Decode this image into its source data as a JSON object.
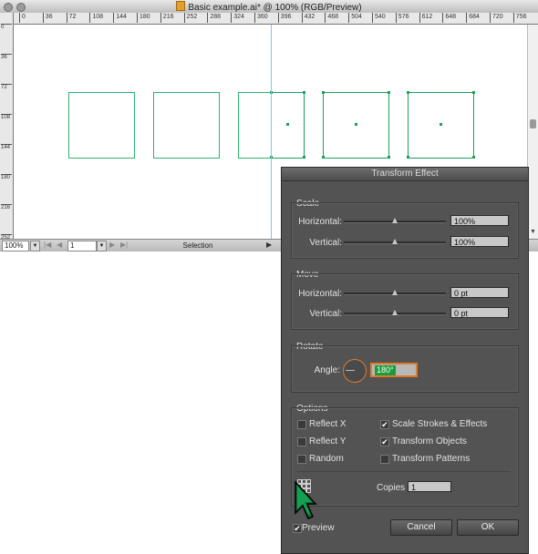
{
  "window": {
    "title": "Basic example.ai* @ 100% (RGB/Preview)"
  },
  "ruler": {
    "h_ticks": [
      "0",
      "36",
      "72",
      "108",
      "144",
      "180",
      "216",
      "252",
      "288",
      "324",
      "360",
      "396",
      "432",
      "468",
      "504",
      "540",
      "576",
      "612",
      "648",
      "684",
      "720",
      "756"
    ],
    "v_ticks": [
      "0",
      "36",
      "72",
      "108",
      "144",
      "180",
      "216",
      "252"
    ]
  },
  "statusbar": {
    "zoom": "100%",
    "page": "1",
    "tool": "Selection"
  },
  "dialog": {
    "title": "Transform Effect",
    "scale": {
      "label": "Scale",
      "horizontal_label": "Horizontal:",
      "horizontal_value": "100%",
      "horizontal_level": 0.5,
      "vertical_label": "Vertical:",
      "vertical_value": "100%",
      "vertical_level": 0.5
    },
    "move": {
      "label": "Move",
      "horizontal_label": "Horizontal:",
      "horizontal_value": "0 pt",
      "horizontal_level": 0.5,
      "vertical_label": "Vertical:",
      "vertical_value": "0 pt",
      "vertical_level": 0.5
    },
    "rotate": {
      "label": "Rotate",
      "angle_label": "Angle:",
      "angle_value": "180°"
    },
    "options": {
      "label": "Options",
      "reflect_x": {
        "label": "Reflect X",
        "checked": false
      },
      "reflect_y": {
        "label": "Reflect Y",
        "checked": false
      },
      "random": {
        "label": "Random",
        "checked": false
      },
      "scale_strokes": {
        "label": "Scale Strokes & Effects",
        "checked": true
      },
      "transform_objects": {
        "label": "Transform Objects",
        "checked": true
      },
      "transform_patterns": {
        "label": "Transform Patterns",
        "checked": false
      },
      "copies_label": "Copies",
      "copies_value": "1"
    },
    "preview": {
      "label": "Preview",
      "checked": true
    },
    "cancel_label": "Cancel",
    "ok_label": "OK"
  },
  "colors": {
    "shape_stroke": "#2db36b",
    "guide": "#6fd0ee",
    "dialog_bg": "#535353",
    "accent_orange": "#e07a2a",
    "angle_highlight": "#1c9c38"
  }
}
